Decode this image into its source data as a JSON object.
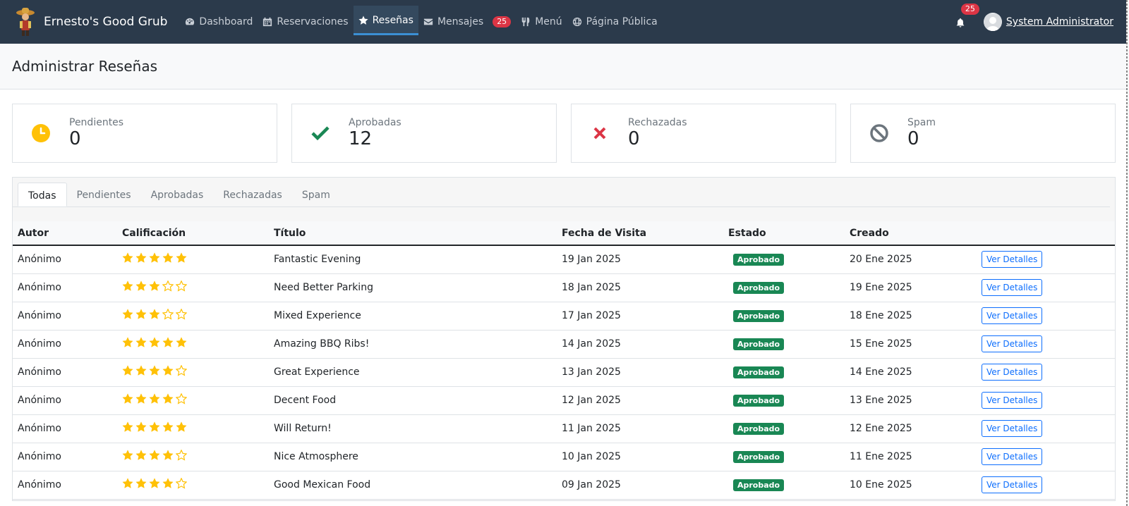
{
  "brand": {
    "name": "Ernesto's Good Grub"
  },
  "nav": [
    {
      "label": "Dashboard",
      "icon": "dashboard-icon",
      "active": false
    },
    {
      "label": "Reservaciones",
      "icon": "calendar-icon",
      "active": false
    },
    {
      "label": "Reseñas",
      "icon": "star-icon",
      "active": true
    },
    {
      "label": "Mensajes",
      "icon": "envelope-icon",
      "active": false,
      "badge": "25"
    },
    {
      "label": "Menú",
      "icon": "utensils-icon",
      "active": false
    },
    {
      "label": "Página Pública",
      "icon": "globe-icon",
      "active": false
    }
  ],
  "notifications": {
    "count": "25",
    "icon": "bell-icon"
  },
  "user": {
    "name": "System Administrator"
  },
  "page": {
    "title": "Administrar Reseñas"
  },
  "stats": [
    {
      "label": "Pendientes",
      "value": "0",
      "icon": "clock-icon",
      "color": "#ffc107"
    },
    {
      "label": "Aprobadas",
      "value": "12",
      "icon": "check-icon",
      "color": "#198754"
    },
    {
      "label": "Rechazadas",
      "value": "0",
      "icon": "x-icon",
      "color": "#dc3545"
    },
    {
      "label": "Spam",
      "value": "0",
      "icon": "ban-icon",
      "color": "#6c757d"
    }
  ],
  "tabs": [
    {
      "label": "Todas",
      "active": true
    },
    {
      "label": "Pendientes",
      "active": false
    },
    {
      "label": "Aprobadas",
      "active": false
    },
    {
      "label": "Rechazadas",
      "active": false
    },
    {
      "label": "Spam",
      "active": false
    }
  ],
  "table": {
    "headers": [
      "Autor",
      "Calificación",
      "Título",
      "Fecha de Visita",
      "Estado",
      "Creado",
      ""
    ],
    "action_label": "Ver Detalles",
    "rows": [
      {
        "author": "Anónimo",
        "rating": 5,
        "title": "Fantastic Evening",
        "visit": "19 Jan 2025",
        "status": "Aprobado",
        "created": "20 Ene 2025"
      },
      {
        "author": "Anónimo",
        "rating": 3,
        "title": "Need Better Parking",
        "visit": "18 Jan 2025",
        "status": "Aprobado",
        "created": "19 Ene 2025"
      },
      {
        "author": "Anónimo",
        "rating": 3,
        "title": "Mixed Experience",
        "visit": "17 Jan 2025",
        "status": "Aprobado",
        "created": "18 Ene 2025"
      },
      {
        "author": "Anónimo",
        "rating": 5,
        "title": "Amazing BBQ Ribs!",
        "visit": "14 Jan 2025",
        "status": "Aprobado",
        "created": "15 Ene 2025"
      },
      {
        "author": "Anónimo",
        "rating": 4,
        "title": "Great Experience",
        "visit": "13 Jan 2025",
        "status": "Aprobado",
        "created": "14 Ene 2025"
      },
      {
        "author": "Anónimo",
        "rating": 4,
        "title": "Decent Food",
        "visit": "12 Jan 2025",
        "status": "Aprobado",
        "created": "13 Ene 2025"
      },
      {
        "author": "Anónimo",
        "rating": 5,
        "title": "Will Return!",
        "visit": "11 Jan 2025",
        "status": "Aprobado",
        "created": "12 Ene 2025"
      },
      {
        "author": "Anónimo",
        "rating": 4,
        "title": "Nice Atmosphere",
        "visit": "10 Jan 2025",
        "status": "Aprobado",
        "created": "11 Ene 2025"
      },
      {
        "author": "Anónimo",
        "rating": 4,
        "title": "Good Mexican Food",
        "visit": "09 Jan 2025",
        "status": "Aprobado",
        "created": "10 Ene 2025"
      }
    ]
  },
  "colors": {
    "navbar": "#2b3a4b",
    "accent": "#3b8fd4",
    "star": "#ffc107",
    "approved": "#198754",
    "danger": "#dc3545",
    "link": "#0d6efd"
  }
}
